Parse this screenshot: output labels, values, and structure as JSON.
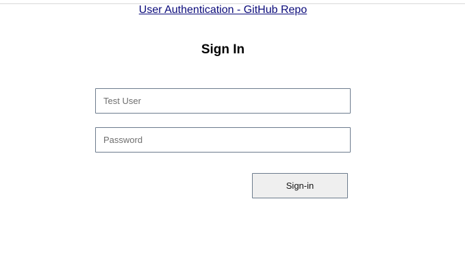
{
  "header": {
    "repo_link_text": "User Authentication - GitHub Repo"
  },
  "form": {
    "title": "Sign In",
    "username": {
      "placeholder": "Test User",
      "value": ""
    },
    "password": {
      "placeholder": "Password",
      "value": ""
    },
    "submit_label": "Sign-in"
  },
  "colors": {
    "link": "#0a0a7a",
    "field_border": "#6b7a8c",
    "button_background": "#efefef"
  }
}
